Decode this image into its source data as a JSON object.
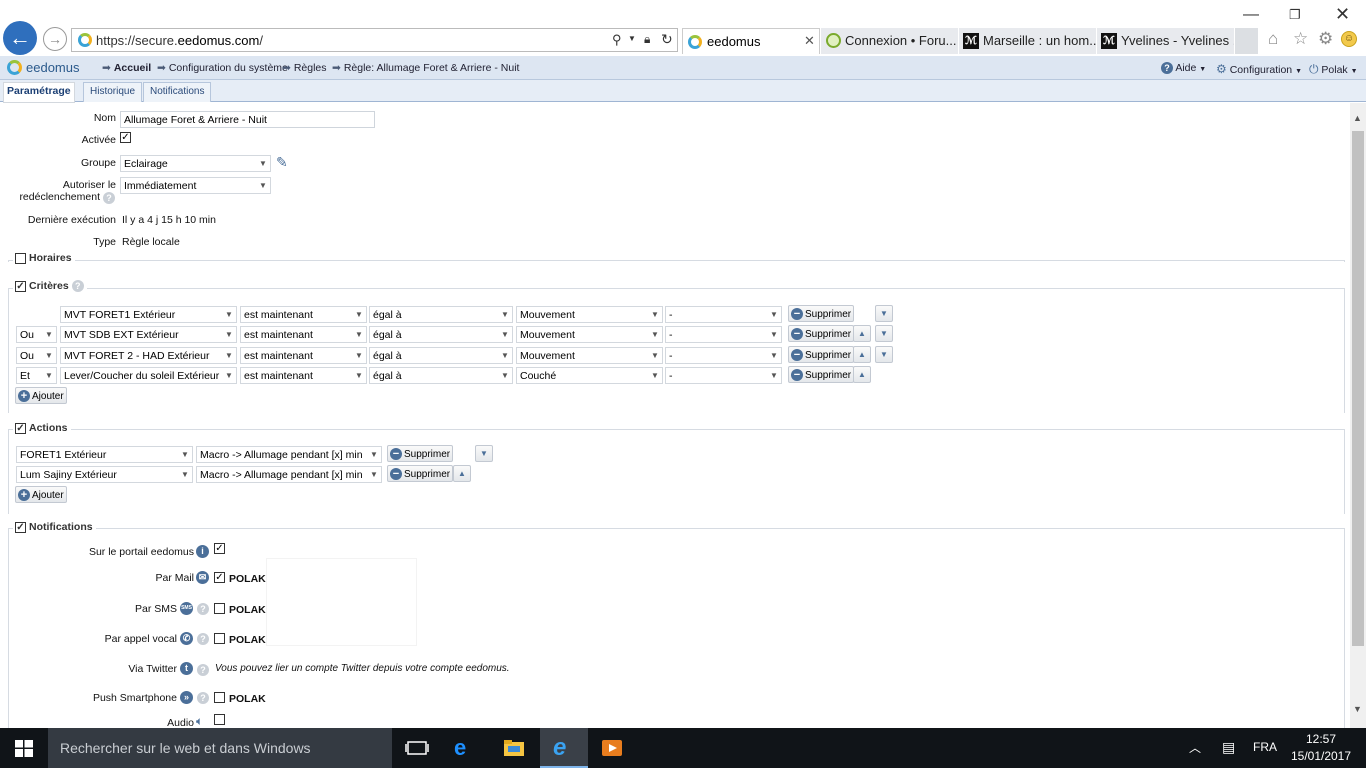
{
  "browser": {
    "url_prefix": "https://secure.",
    "url_host": "eedomus.com",
    "url_suffix": "/",
    "tabs": [
      {
        "label": "eedomus"
      },
      {
        "label": "Connexion • Foru..."
      },
      {
        "label": "Marseille : un hom..."
      },
      {
        "label": "Yvelines - Yvelines ..."
      }
    ]
  },
  "app": {
    "logo": "eedomus",
    "breadcrumb": [
      "Accueil",
      "Configuration du système",
      "Règles",
      "Règle: Allumage Foret & Arriere - Nuit"
    ],
    "menu": {
      "help": "Aide",
      "config": "Configuration",
      "user": "Polak"
    },
    "tabs": [
      "Paramétrage",
      "Historique",
      "Notifications"
    ]
  },
  "form": {
    "nom_label": "Nom",
    "nom_value": "Allumage Foret & Arriere - Nuit",
    "active_label": "Activée",
    "groupe_label": "Groupe",
    "groupe_value": "Eclairage",
    "redecl_label1": "Autoriser le",
    "redecl_label2": "redéclenchement",
    "redecl_value": "Immédiatement",
    "derniere_label": "Dernière exécution",
    "derniere_value": "Il y a 4 j 15 h 10 min",
    "type_label": "Type",
    "type_value": "Règle locale"
  },
  "sections": {
    "horaires": "Horaires",
    "criteres": "Critères",
    "actions": "Actions",
    "notifications": "Notifications"
  },
  "criteria": [
    {
      "logic": "",
      "device": "MVT FORET1 Extérieur",
      "state": "est maintenant",
      "op": "égal à",
      "value": "Mouvement",
      "extra": "-"
    },
    {
      "logic": "Ou",
      "device": "MVT SDB EXT Extérieur",
      "state": "est maintenant",
      "op": "égal à",
      "value": "Mouvement",
      "extra": "-"
    },
    {
      "logic": "Ou",
      "device": "MVT FORET 2 - HAD Extérieur",
      "state": "est maintenant",
      "op": "égal à",
      "value": "Mouvement",
      "extra": "-"
    },
    {
      "logic": "Et",
      "device": "Lever/Coucher du soleil Extérieur",
      "state": "est maintenant",
      "op": "égal à",
      "value": "Couché",
      "extra": "-"
    }
  ],
  "actions": [
    {
      "device": "FORET1 Extérieur",
      "action": "Macro -> Allumage pendant [x] min"
    },
    {
      "device": "Lum Sajiny Extérieur",
      "action": "Macro -> Allumage pendant [x] min"
    }
  ],
  "buttons": {
    "delete": "Supprimer",
    "add": "Ajouter"
  },
  "notifications": {
    "portail": "Sur le portail eedomus",
    "mail": "Par Mail",
    "sms": "Par SMS",
    "vocal": "Par appel vocal",
    "twitter": "Via Twitter",
    "twitter_text": "Vous pouvez lier un compte Twitter depuis votre compte eedomus.",
    "push": "Push Smartphone",
    "audio": "Audio",
    "user": "POLAK"
  },
  "taskbar": {
    "search_placeholder": "Rechercher sur le web et dans Windows",
    "lang": "FRA",
    "time": "12:57",
    "date": "15/01/2017"
  }
}
